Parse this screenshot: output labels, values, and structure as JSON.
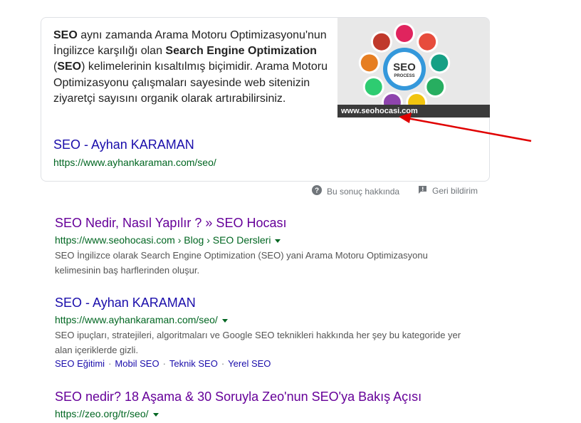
{
  "featured_snippet": {
    "text_parts": [
      {
        "t": "SEO",
        "b": true
      },
      {
        "t": " aynı zamanda Arama Motoru Optimizasyonu'nun İngilizce karşılığı olan ",
        "b": false
      },
      {
        "t": "Search Engine Optimization",
        "b": true
      },
      {
        "t": " (",
        "b": false
      },
      {
        "t": "SEO",
        "b": true
      },
      {
        "t": ") kelimelerinin kısaltılmış biçimidir. Arama Motoru Optimizasyonu çalışmaları sayesinde web sitenizin ziyaretçi sayısını organik olarak artırabilirsiniz.",
        "b": false
      }
    ],
    "link_title": "SEO - Ayhan KARAMAN",
    "link_url": "https://www.ayhankaraman.com/seo/",
    "image": {
      "center_line1": "SEO",
      "center_line2": "PROCESS",
      "caption": "www.seohocasi.com",
      "node_colors": [
        "#e0245e",
        "#e74c3c",
        "#16a085",
        "#27ae60",
        "#f1c40f",
        "#8e44ad",
        "#2ecc71",
        "#e67e22",
        "#c0392b"
      ],
      "center_color": "#3498db"
    }
  },
  "feedback": {
    "about_label": "Bu sonuç hakkında",
    "feedback_label": "Geri bildirim"
  },
  "results": [
    {
      "title": "SEO Nedir, Nasıl Yapılır ? » SEO Hocası",
      "url": "https://www.seohocasi.com › Blog › SEO Dersleri",
      "desc": "SEO İngilizce olarak Search Engine Optimization (SEO) yani Arama Motoru Optimizasyonu kelimesinin baş harflerinden oluşur.",
      "visited": true
    },
    {
      "title": "SEO - Ayhan KARAMAN",
      "url": "https://www.ayhankaraman.com/seo/",
      "desc": "SEO ipuçları, stratejileri, algoritmaları ve Google SEO teknikleri hakkında her şey bu kategoride yer alan içeriklerde gizli.",
      "visited": false,
      "sitelinks": [
        "SEO Eğitimi",
        "Mobil SEO",
        "Teknik SEO",
        "Yerel SEO"
      ]
    },
    {
      "title": "SEO nedir? 18 Aşama & 30 Soruyla Zeo'nun SEO'ya Bakış Açısı",
      "url": "https://zeo.org/tr/seo/",
      "visited": true
    }
  ],
  "annotation": {
    "arrow_color": "#e00000"
  }
}
